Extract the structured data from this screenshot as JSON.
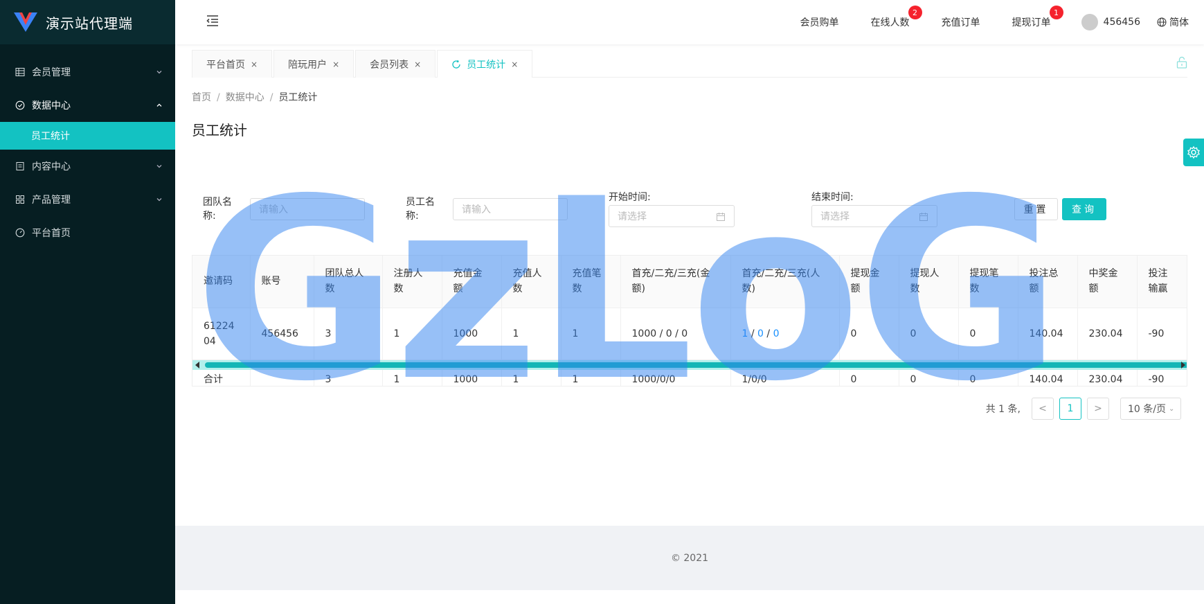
{
  "app": {
    "title": "演示站代理端"
  },
  "sidebar": {
    "items": [
      {
        "label": "会员管理"
      },
      {
        "label": "数据中心"
      },
      {
        "label": "员工统计"
      },
      {
        "label": "内容中心"
      },
      {
        "label": "产品管理"
      },
      {
        "label": "平台首页"
      }
    ]
  },
  "header": {
    "nav": [
      {
        "label": "会员购单"
      },
      {
        "label": "在线人数",
        "badge": "2"
      },
      {
        "label": "充值订单"
      },
      {
        "label": "提现订单",
        "badge": "1"
      }
    ],
    "user": "456456",
    "lang": "简体"
  },
  "tabs": [
    {
      "label": "平台首页"
    },
    {
      "label": "陪玩用户"
    },
    {
      "label": "会员列表"
    },
    {
      "label": "员工统计"
    }
  ],
  "tab_close": "×",
  "breadcrumb": [
    "首页",
    "数据中心",
    "员工统计"
  ],
  "breadcrumb_sep": "/",
  "page_title": "员工统计",
  "filter": {
    "team_label_1": "团队名",
    "team_label_2": "称:",
    "team_placeholder": "请输入",
    "staff_label_1": "员工名",
    "staff_label_2": "称:",
    "staff_placeholder": "请输入",
    "start_label": "开始时间:",
    "start_placeholder": "请选择",
    "end_label": "结束时间:",
    "end_placeholder": "请选择",
    "reset": "重置",
    "query": "查询"
  },
  "table": {
    "headers": [
      "邀请码",
      "账号",
      "团队总人数",
      "注册人数",
      "充值金额",
      "充值人数",
      "充值笔数",
      "首充/二充/三充(金额)",
      "首充/二充/三充(人数)",
      "提现金额",
      "提现人数",
      "提现笔数",
      "投注总额",
      "中奖金额",
      "投注输赢"
    ],
    "row": {
      "code": "6122404",
      "account": "456456",
      "team": "3",
      "reg": "1",
      "recharge_amt": "1000",
      "recharge_ppl": "1",
      "recharge_cnt": "1",
      "first_amt": "1000 / 0 / 0",
      "first_ppl_1": "1",
      "first_ppl_2": "0",
      "first_ppl_3": "0",
      "slash": "/",
      "wd_amt": "0",
      "wd_ppl": "0",
      "wd_cnt": "0",
      "bet": "140.04",
      "win": "230.04",
      "net": "-90"
    },
    "sum": {
      "label": "合计",
      "team": "3",
      "reg": "1",
      "recharge_amt": "1000",
      "recharge_ppl": "1",
      "recharge_cnt": "1",
      "first_amt": "1000/0/0",
      "first_ppl": "1/0/0",
      "wd_amt": "0",
      "wd_ppl": "0",
      "wd_cnt": "0",
      "bet": "140.04",
      "win": "230.04",
      "net": "-90"
    }
  },
  "pagination": {
    "total": "共 1 条,",
    "current": "1",
    "size": "10 条/页",
    "prev": "<",
    "next": ">"
  },
  "footer": {
    "text": "© 2021"
  },
  "watermark": "GzLoG",
  "colors": {
    "accent": "#13c2c2",
    "sidebar": "#061e22",
    "badge": "#f5222d",
    "link": "#1890ff"
  }
}
